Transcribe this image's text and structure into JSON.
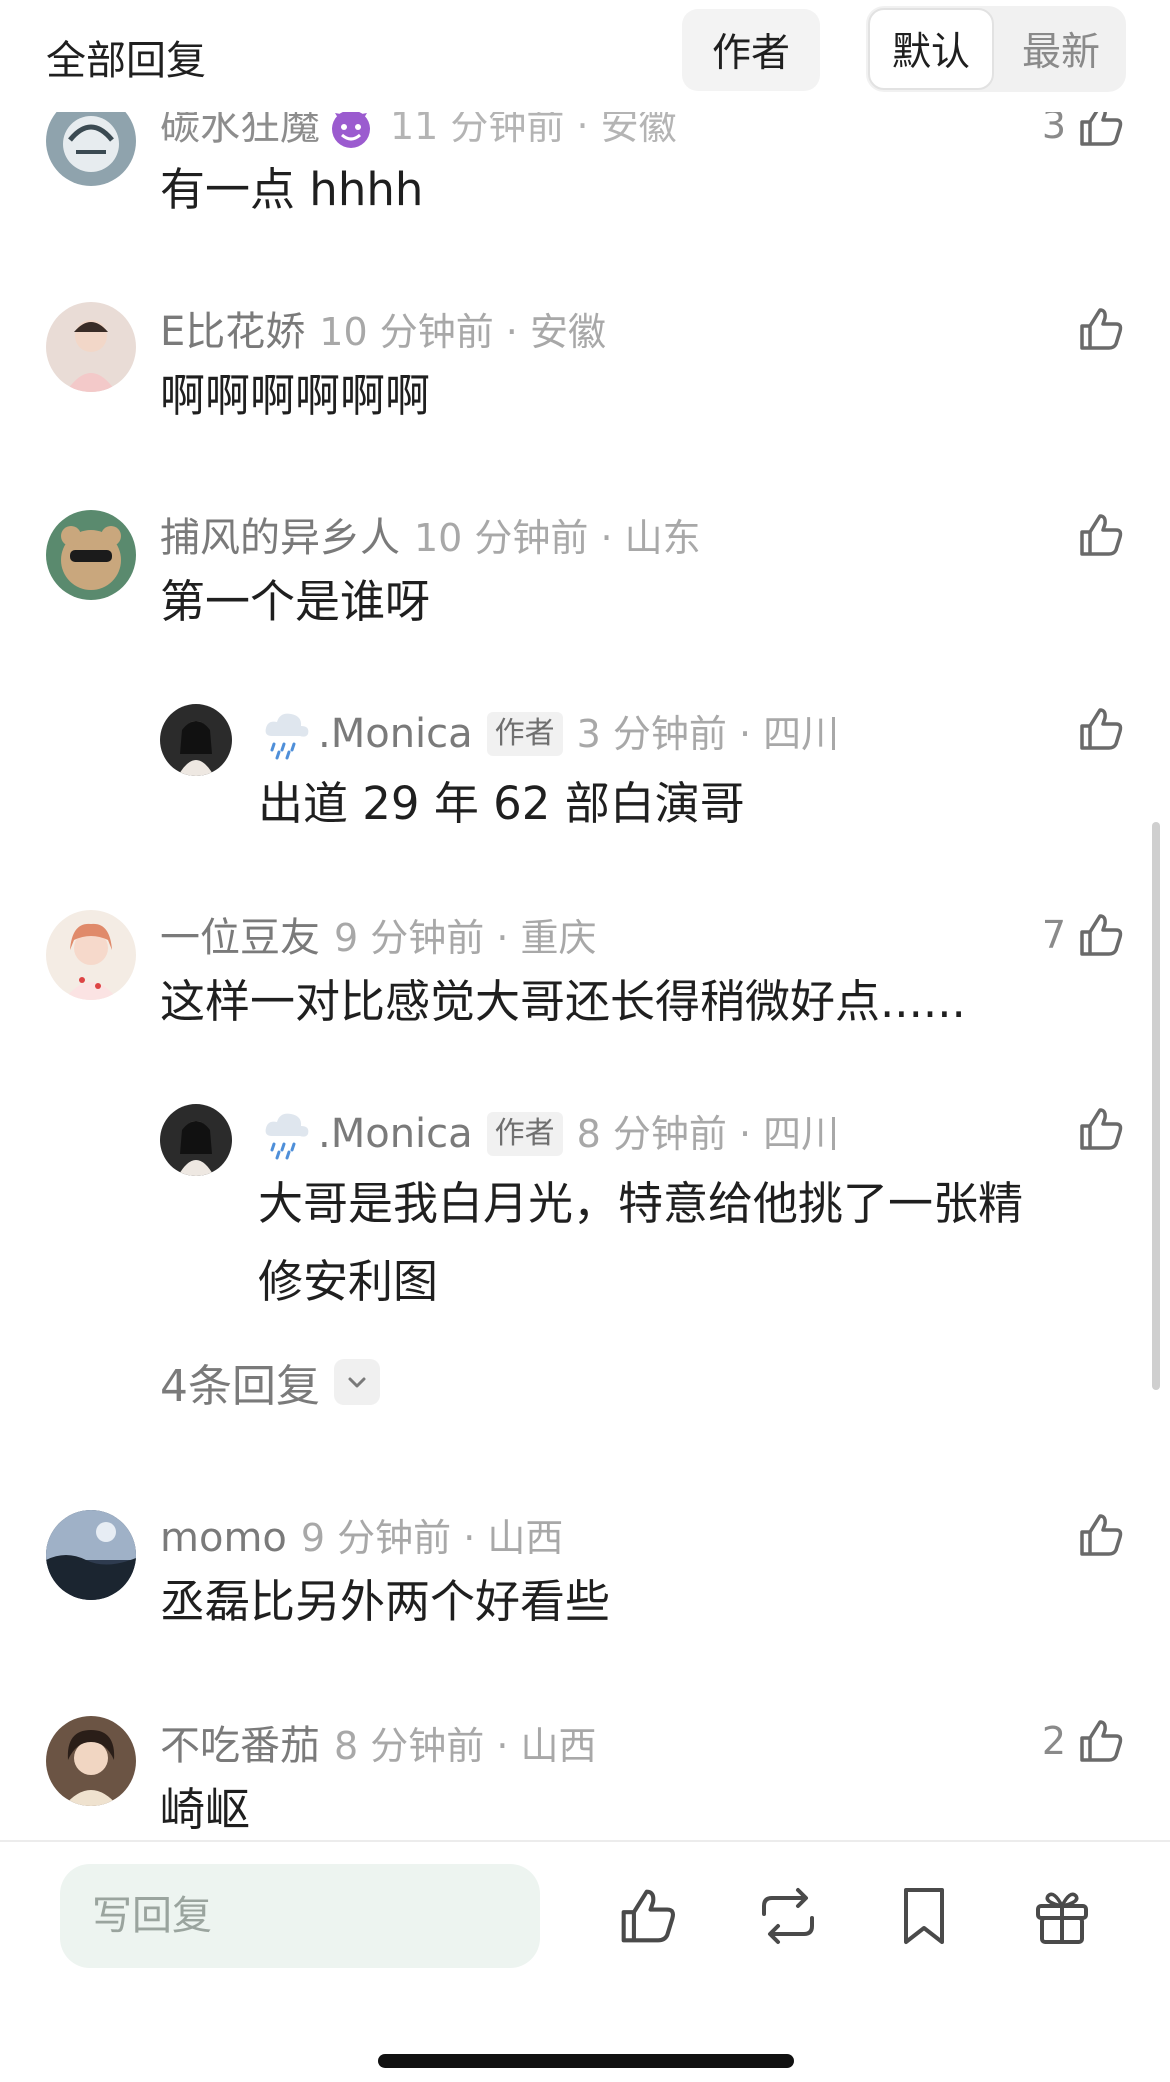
{
  "header": {
    "title": "全部回复",
    "author_filter": "作者",
    "sort_default": "默认",
    "sort_latest": "最新"
  },
  "comments": [
    {
      "user": "碳水狂魔",
      "time": "11 分钟前 · 安徽",
      "text": "有一点 hhhh",
      "likes": "3"
    },
    {
      "user": "E比花娇",
      "time": "10 分钟前 · 安徽",
      "text": "啊啊啊啊啊啊",
      "likes": ""
    },
    {
      "user": "捕风的异乡人",
      "time": "10 分钟前 · 山东",
      "text": "第一个是谁呀",
      "likes": ""
    },
    {
      "user": ".Monica",
      "author_tag": "作者",
      "time": "3 分钟前 · 四川",
      "text": "出道 29 年 62 部白演哥",
      "likes": ""
    },
    {
      "user": "一位豆友",
      "time": "9 分钟前 · 重庆",
      "text": "这样一对比感觉大哥还长得稍微好点......",
      "likes": "7"
    },
    {
      "user": ".Monica",
      "author_tag": "作者",
      "time": "8 分钟前 · 四川",
      "text_line1": "大哥是我白月光，特意给他挑了一张精",
      "text_line2": "修安利图",
      "likes": ""
    },
    {
      "user": "momo",
      "time": "9 分钟前 · 山西",
      "text": "丞磊比另外两个好看些",
      "likes": ""
    },
    {
      "user": "不吃番茄",
      "time": "8 分钟前 · 山西",
      "text": "崎岖",
      "likes": "2"
    }
  ],
  "replies_toggle": "4条回复",
  "bottom_bar": {
    "reply_placeholder": "写回复"
  },
  "icons": {
    "like": "thumbs-up-icon",
    "repost": "repost-icon",
    "bookmark": "bookmark-icon",
    "gift": "gift-icon",
    "expand": "chevron-down-icon"
  },
  "colors": {
    "meta_gray": "#7a7a7a",
    "time_gray": "#a8a8a8",
    "input_bg": "#edf4f0"
  }
}
